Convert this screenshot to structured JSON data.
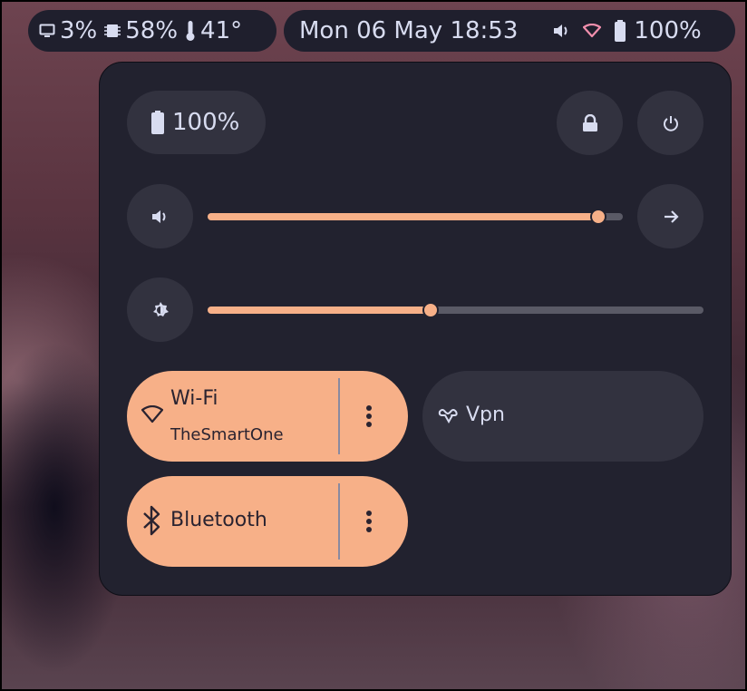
{
  "topbar": {
    "cpu": "3%",
    "memory": "58%",
    "temperature": "41°",
    "clock": "Mon 06 May 18:53",
    "battery": "100%",
    "icons": [
      "monitor-icon",
      "memory-chip-icon",
      "thermometer-icon",
      "volume-icon",
      "wifi-icon",
      "battery-icon"
    ]
  },
  "panel": {
    "battery_label": "100%",
    "volume_level": 0.94,
    "brightness_level": 0.45,
    "wifi": {
      "title": "Wi-Fi",
      "network": "TheSmartOne",
      "on": true
    },
    "vpn": {
      "title": "Vpn",
      "on": false
    },
    "bluetooth": {
      "title": "Bluetooth",
      "on": true
    }
  },
  "colors": {
    "accent": "#f7b088",
    "panel_bg": "#22222f",
    "button_bg": "#32323f",
    "text": "#d8dcf0",
    "wifi_indicator": "#f28fad"
  }
}
